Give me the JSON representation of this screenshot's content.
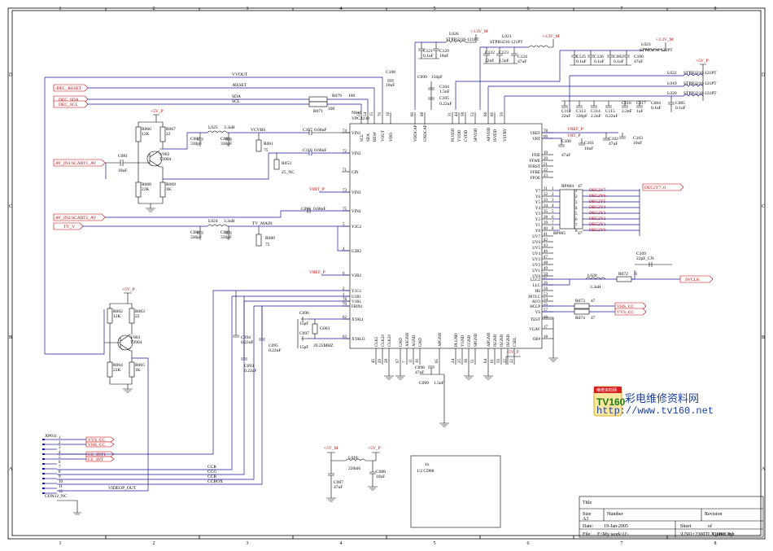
{
  "border": {
    "columns": [
      "1",
      "2",
      "3",
      "4",
      "5",
      "6",
      "7",
      "8"
    ],
    "rows": [
      "D",
      "C",
      "B",
      "A"
    ]
  },
  "ic": {
    "ref": "N010",
    "part": "VPC3230",
    "pins_left": [
      {
        "name": "VIN1",
        "num": "74"
      },
      {
        "name": "VIN2",
        "num": "72"
      },
      {
        "name": "CIN",
        "num": "71"
      },
      {
        "name": "VIN3",
        "num": "73"
      },
      {
        "name": "VIN4",
        "num": "75"
      },
      {
        "name": "Y2G2",
        "num": "5"
      },
      {
        "name": "U2B2",
        "num": "4"
      },
      {
        "name": "V2R2",
        "num": "6"
      },
      {
        "name": "Y1G1",
        "num": "2"
      },
      {
        "name": "U1B1",
        "num": "1"
      },
      {
        "name": "V1R1",
        "num": "78"
      },
      {
        "name": "FBIN1",
        "num": "79"
      },
      {
        "name": "XTALI",
        "num": "62"
      },
      {
        "name": "XTALO",
        "num": "63"
      }
    ],
    "pins_top": [
      {
        "name": "SCL",
        "num": "13"
      },
      {
        "name": "SDA",
        "num": "14"
      },
      {
        "name": "RES#",
        "num": "15"
      },
      {
        "name": "VOUT",
        "num": "70"
      },
      {
        "name": "VDD",
        "num": "16"
      },
      {
        "name": "VDDCAP",
        "num": "69"
      },
      {
        "name": "GNDCAP",
        "num": "68"
      },
      {
        "name": "PLVDD",
        "num": "31"
      },
      {
        "name": "YVDD",
        "num": "44"
      },
      {
        "name": "CVDD",
        "num": "58"
      },
      {
        "name": "SPVDD",
        "num": "52"
      },
      {
        "name": "APVDD",
        "num": "66"
      },
      {
        "name": "ISVDD",
        "num": "60"
      },
      {
        "name": "VSTBY",
        "num": "59"
      }
    ],
    "pins_right": [
      {
        "name": "VREF",
        "num": "78"
      },
      {
        "name": "VRT",
        "num": "66"
      },
      {
        "name": "FFIE",
        "num": "19"
      },
      {
        "name": "FFWE",
        "num": "20"
      },
      {
        "name": "FFRST",
        "num": "21"
      },
      {
        "name": "FFRE",
        "num": "22"
      },
      {
        "name": "FFOE",
        "num": "23"
      },
      {
        "name": "Y7",
        "num": "31"
      },
      {
        "name": "Y6",
        "num": "32"
      },
      {
        "name": "Y5",
        "num": "33"
      },
      {
        "name": "Y4",
        "num": "34"
      },
      {
        "name": "Y3",
        "num": "35"
      },
      {
        "name": "Y2",
        "num": "38"
      },
      {
        "name": "Y1",
        "num": "39"
      },
      {
        "name": "Y0",
        "num": "40"
      },
      {
        "name": "UV7",
        "num": "41"
      },
      {
        "name": "UV6",
        "num": "42"
      },
      {
        "name": "UV5",
        "num": "43"
      },
      {
        "name": "UV4",
        "num": "46"
      },
      {
        "name": "UV3",
        "num": "47"
      },
      {
        "name": "UV2",
        "num": "48"
      },
      {
        "name": "UV1",
        "num": "49"
      },
      {
        "name": "UV0",
        "num": "50"
      },
      {
        "name": "LLC2",
        "num": "27"
      },
      {
        "name": "LLC",
        "num": "26"
      },
      {
        "name": "HS",
        "num": "56"
      },
      {
        "name": "INTLC",
        "num": "53"
      },
      {
        "name": "AVO",
        "num": "54"
      },
      {
        "name": "HCLP",
        "num": "55"
      },
      {
        "name": "VS",
        "num": "57"
      },
      {
        "name": "TEST",
        "num": "16"
      },
      {
        "name": "VGAV",
        "num": "17"
      },
      {
        "name": "OE#",
        "num": "18"
      }
    ],
    "pins_bottom": [
      {
        "name": "CLK5",
        "num": "45"
      },
      {
        "name": "CLK20",
        "num": "29"
      },
      {
        "name": "CLK20",
        "num": "28"
      },
      {
        "name": "GND",
        "num": "67"
      },
      {
        "name": "ASGND",
        "num": "7"
      },
      {
        "name": "AGND",
        "num": "11"
      },
      {
        "name": "GND",
        "num": "30"
      },
      {
        "name": "APGND",
        "num": "65"
      },
      {
        "name": "PLGND",
        "num": "24"
      },
      {
        "name": "YGND",
        "num": "25"
      },
      {
        "name": "CGND",
        "num": "36"
      },
      {
        "name": "SPGND",
        "num": "51"
      },
      {
        "name": "APGND",
        "num": "64"
      },
      {
        "name": "ISGND",
        "num": "61"
      },
      {
        "name": "ISGND",
        "num": "59"
      },
      {
        "name": "ISGND",
        "num": "37"
      },
      {
        "name": "CSEL",
        "num": "22"
      }
    ]
  },
  "nets": {
    "dec_reset": "/DEC_RESET",
    "dec_sda": "DEC_SDA",
    "dec_scl": "DEC_SCL",
    "vvout": "VVOUT",
    "reset": "/RESET",
    "sda": "SDA",
    "scl": "SCL",
    "av_in1": "AV_IN1/SCART1_AV",
    "av_in2": "AV_IN2/SCART2_AV",
    "tv_v": "TV_V",
    "vcvbs": "VCVBS",
    "tv_main": "TV_MAIN",
    "vbit_p": "VBIT_P",
    "vref_p": "VREF_P",
    "vref_p2": "VREF_P",
    "vrt_p": "VRT_P",
    "dec2y7": "DEC2Y7..0",
    "dec_bus": [
      "DEC2Y7",
      "DEC2Y6",
      "DEC2Y5",
      "DEC2Y4",
      "DEC2Y3",
      "DEC2Y2",
      "DEC2Y1",
      "DEC2Y0"
    ],
    "svclk": "SVCLK",
    "vhs_cc": "VHS_CC",
    "vvs_cc": "VVS_CC",
    "ccr": "CCR",
    "ccg": "CCG",
    "ccb": "CCB",
    "ccbox": "CCBOX",
    "videop_out": "VIDEOP_OUT",
    "plus5v_p": "+5V_P",
    "plus5v_m": "+5V_M",
    "plus3v3_m": "+3.3V_M",
    "plus3v3_m2": "+3.3V_M",
    "plus3v3_m3": "+3.3V_M",
    "plus5v_p2": "+5V_P",
    "plus5v_p3": "+5V_P",
    "plus5v_p4": "+5V_P",
    "plus5v_p5": "+5V_P",
    "nc": "25_NC"
  },
  "parts": {
    "r066": {
      "ref": "R066",
      "val": "12K"
    },
    "r067": {
      "ref": "R067",
      "val": "22"
    },
    "r068": {
      "ref": "R068",
      "val": "22K"
    },
    "r069": {
      "ref": "R069",
      "val": "1K"
    },
    "v002": {
      "ref": "V002",
      "val": "T3904"
    },
    "c081": {
      "ref": "C081",
      "val": "10uF"
    },
    "l025": {
      "ref": "L025",
      "val": "3.3uH"
    },
    "c082": {
      "ref": "C082",
      "val": "330pF"
    },
    "c086": {
      "ref": "C086",
      "val": "330pF"
    },
    "r061": {
      "ref": "R061",
      "val": "75"
    },
    "c107": {
      "ref": "C107",
      "val": "0.68uF"
    },
    "c110": {
      "ref": "C110",
      "val": "0.68uF"
    },
    "r053": {
      "ref": "R053",
      "val": ""
    },
    "r079": {
      "ref": "R079",
      "val": "100"
    },
    "r071": {
      "ref": "R071",
      "val": "100"
    },
    "c108": {
      "ref": "C108",
      "val": "10uF"
    },
    "c098": {
      "ref": "C098",
      "val": "0.68uF"
    },
    "l024": {
      "ref": "L024",
      "val": "3.3uH"
    },
    "c080": {
      "ref": "C080",
      "val": "330pF"
    },
    "c081b": {
      "ref": "C081",
      "val": "330pF"
    },
    "r080": {
      "ref": "R080",
      "val": "75"
    },
    "c096": {
      "ref": "C096",
      "val": "15pF"
    },
    "c097": {
      "ref": "C097",
      "val": "15pF"
    },
    "g003": {
      "ref": "G003",
      "val": "20.25MHZ"
    },
    "c094": {
      "ref": "C094",
      "val": "0.22uF"
    },
    "c093": {
      "ref": "C093",
      "val": "0.22uF"
    },
    "c095": {
      "ref": "C095",
      "val": "0.22uF"
    },
    "r062": {
      "ref": "R062",
      "val": "12K"
    },
    "r063": {
      "ref": "R063",
      "val": "22"
    },
    "r064": {
      "ref": "R064",
      "val": "22K"
    },
    "r065": {
      "ref": "R065",
      "val": "1K"
    },
    "v003": {
      "ref": "V003",
      "val": "T3904"
    },
    "l026": {
      "ref": "L026",
      "val": "STPB3216-121PT"
    },
    "l021": {
      "ref": "L021",
      "val": "STPB3216-121PT"
    },
    "l023": {
      "ref": "L023",
      "val": "STPB3216-121PT"
    },
    "l022": {
      "ref": "L022",
      "val": "STPB3216-121PT"
    },
    "l019": {
      "ref": "L019",
      "val": "STPB3216-121PT"
    },
    "l020": {
      "ref": "L020",
      "val": "STPB3216-121PT"
    },
    "c121": {
      "ref": "C121",
      "val": "0.1uF"
    },
    "c120": {
      "ref": "C120",
      "val": "10uF"
    },
    "c122": {
      "ref": "C122",
      "val": "22nF"
    },
    "c123": {
      "ref": "C123",
      "val": "1.5nF"
    },
    "c124": {
      "ref": "C124",
      "val": "47uF"
    },
    "c125": {
      "ref": "C125",
      "val": "0.1uF"
    },
    "c126": {
      "ref": "C126",
      "val": "0.1uF"
    },
    "c082b": {
      "ref": "C082",
      "val": "0.1uF"
    },
    "c100": {
      "ref": "C100",
      "val": "47uF"
    },
    "c099": {
      "ref": "C099",
      "val": "150pF"
    },
    "c104": {
      "ref": "C104",
      "val": "1.5nF"
    },
    "c105": {
      "ref": "C105",
      "val": "0.22uF"
    },
    "c112": {
      "ref": "C112",
      "val": "22nF"
    },
    "c113": {
      "ref": "C113",
      "val": "330pF"
    },
    "c114": {
      "ref": "C114",
      "val": "2.2nF"
    },
    "c115": {
      "ref": "C115",
      "val": "0.22uF"
    },
    "c116": {
      "ref": "C116",
      "val": "2.2nF"
    },
    "c117": {
      "ref": "C117",
      "val": "1uF"
    },
    "c084": {
      "ref": "C084",
      "val": "0.1uF"
    },
    "c085": {
      "ref": "C085",
      "val": "0.1uF"
    },
    "c101": {
      "ref": "C101",
      "val": "10uF"
    },
    "c100b": {
      "ref": "C100",
      "val": "47uF"
    },
    "c102": {
      "ref": "C102",
      "val": "47uF"
    },
    "c103": {
      "ref": "C103",
      "val": "10uF"
    },
    "rp004": {
      "ref": "RP004",
      "val": "47"
    },
    "rp005": {
      "ref": "RP005",
      "val": "47"
    },
    "c109": {
      "ref": "C109",
      "val": "22pF_CN"
    },
    "l028": {
      "ref": "L028",
      "val": "3.3uH"
    },
    "r072": {
      "ref": "R072",
      "val": "0"
    },
    "r073": {
      "ref": "R073",
      "val": "47"
    },
    "r074": {
      "ref": "R074",
      "val": "47"
    },
    "c098b": {
      "ref": "C098",
      "val": "47nF"
    },
    "c099b": {
      "ref": "C099",
      "val": "1.5nF"
    },
    "l018": {
      "ref": "L018",
      "val": "220nH"
    },
    "c087": {
      "ref": "C087",
      "val": "47uF"
    },
    "c088": {
      "ref": "C088",
      "val": "10uF"
    }
  },
  "connector": {
    "ref": "XP011",
    "part": "CON12_NC",
    "pins": [
      "1",
      "2",
      "3",
      "4",
      "5",
      "6",
      "7",
      "8",
      "9",
      "10",
      "11",
      "12"
    ],
    "nets": [
      "VVS_CC",
      "VHS_CC",
      "",
      "CC_INT1",
      "CC_INT",
      "",
      "",
      "",
      "",
      "",
      "",
      ""
    ]
  },
  "note": {
    "line1": "1x",
    "line2": "1/2 CD88"
  },
  "watermark": {
    "brand": "TV160",
    "slogan": "彩电维修资料网",
    "url": "http://www.tv160.net",
    "badge": "维修资料网"
  },
  "title_block": {
    "title_label": "Title",
    "size_label": "Size",
    "size": "A3",
    "number_label": "Number",
    "revision_label": "Revision",
    "date_label": "Date:",
    "date": "19-Jan-2005",
    "sheet_label": "Sheet",
    "of_label": "of",
    "file_label": "File:",
    "file": "F:\\My work\\11\\",
    "drawn_by_label": "Drawn By:",
    "file2": "\\U501+2300TLX_DEC.sch"
  }
}
